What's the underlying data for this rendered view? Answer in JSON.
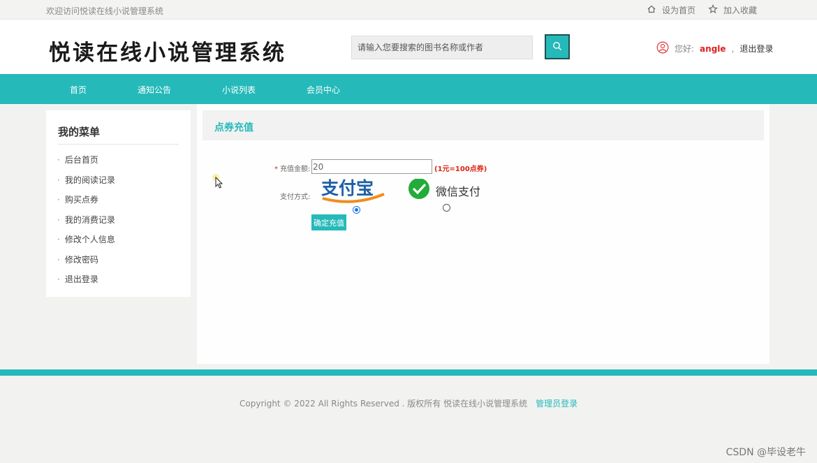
{
  "topbar": {
    "welcome": "欢迎访问悦读在线小说管理系统",
    "set_home": "设为首页",
    "add_favorite": "加入收藏"
  },
  "header": {
    "logo": "悦读在线小说管理系统",
    "search_placeholder": "请输入您要搜索的图书名称或作者",
    "greeting": "您好:",
    "username": "angle",
    "separator": ",",
    "logout": "退出登录"
  },
  "nav": {
    "items": [
      "首页",
      "通知公告",
      "小说列表",
      "会员中心"
    ]
  },
  "sidebar": {
    "title": "我的菜单",
    "items": [
      "后台首页",
      "我的阅读记录",
      "购买点券",
      "我的消费记录",
      "修改个人信息",
      "修改密码",
      "退出登录"
    ]
  },
  "main": {
    "title": "点券充值",
    "amount_required_mark": "*",
    "amount_label": "充值金额:",
    "amount_value": "20",
    "rate_hint": "(1元=100点券)",
    "pay_label": "支付方式:",
    "alipay_text": "支付宝",
    "wechat_text": "微信支付",
    "selected_method": "alipay",
    "submit_label": "确定充值"
  },
  "footer": {
    "copyright": "Copyright © 2022 All Rights Reserved . 版权所有  悦读在线小说管理系统",
    "admin_login": "管理员登录",
    "watermark": "CSDN @毕设老牛"
  },
  "colors": {
    "accent": "#26b9b9",
    "highlight": "#e02020"
  }
}
